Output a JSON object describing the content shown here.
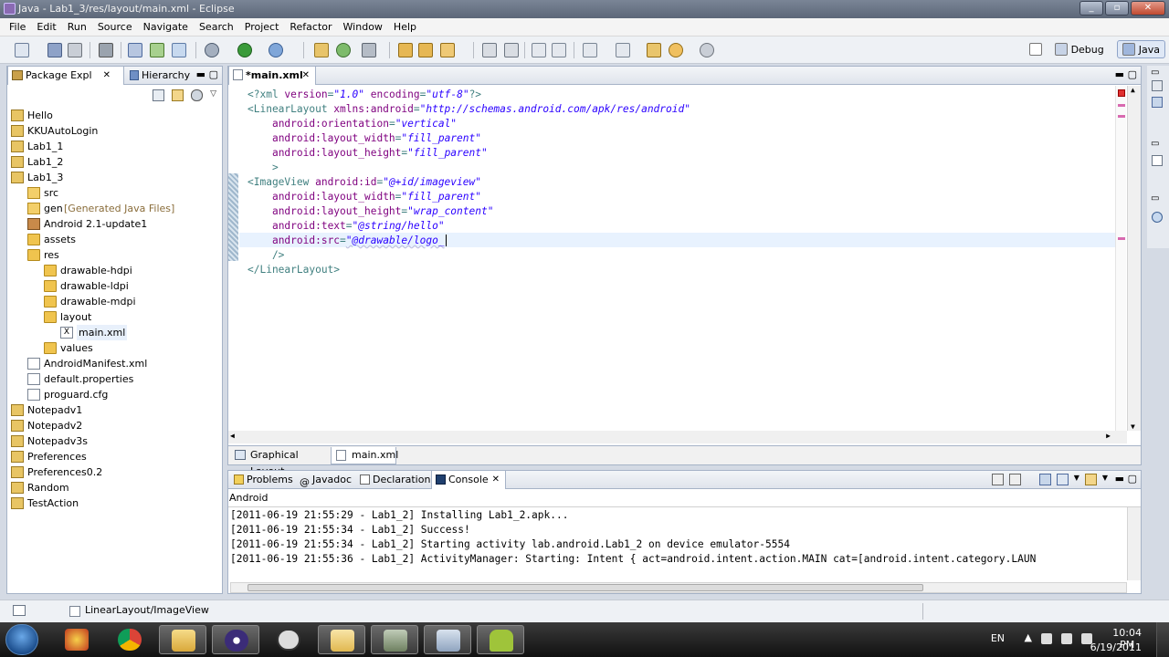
{
  "window": {
    "title": "Java - Lab1_3/res/layout/main.xml - Eclipse"
  },
  "menu": [
    "File",
    "Edit",
    "Run",
    "Source",
    "Navigate",
    "Search",
    "Project",
    "Refactor",
    "Window",
    "Help"
  ],
  "perspectives": {
    "debug": "Debug",
    "java": "Java"
  },
  "left_panel": {
    "tabs": [
      "Package Expl",
      "Hierarchy"
    ],
    "tree": [
      {
        "label": "Hello",
        "type": "project",
        "depth": 0
      },
      {
        "label": "KKUAutoLogin",
        "type": "project",
        "depth": 0
      },
      {
        "label": "Lab1_1",
        "type": "project",
        "depth": 0
      },
      {
        "label": "Lab1_2",
        "type": "project",
        "depth": 0
      },
      {
        "label": "Lab1_3",
        "type": "project",
        "depth": 0
      },
      {
        "label": "src",
        "type": "srcfolder",
        "depth": 1
      },
      {
        "label": "gen",
        "type": "srcfolder",
        "depth": 1,
        "decoration": "[Generated Java Files]"
      },
      {
        "label": "Android 2.1-update1",
        "type": "library",
        "depth": 1
      },
      {
        "label": "assets",
        "type": "folder",
        "depth": 1
      },
      {
        "label": "res",
        "type": "folder",
        "depth": 1
      },
      {
        "label": "drawable-hdpi",
        "type": "folder",
        "depth": 2
      },
      {
        "label": "drawable-ldpi",
        "type": "folder",
        "depth": 2
      },
      {
        "label": "drawable-mdpi",
        "type": "folder",
        "depth": 2
      },
      {
        "label": "layout",
        "type": "folder",
        "depth": 2
      },
      {
        "label": "main.xml",
        "type": "xmlfile",
        "depth": 3
      },
      {
        "label": "values",
        "type": "folder",
        "depth": 2
      },
      {
        "label": "AndroidManifest.xml",
        "type": "file",
        "depth": 1
      },
      {
        "label": "default.properties",
        "type": "file",
        "depth": 1
      },
      {
        "label": "proguard.cfg",
        "type": "file",
        "depth": 1
      },
      {
        "label": "Notepadv1",
        "type": "project",
        "depth": 0
      },
      {
        "label": "Notepadv2",
        "type": "project",
        "depth": 0
      },
      {
        "label": "Notepadv3s",
        "type": "project",
        "depth": 0
      },
      {
        "label": "Preferences",
        "type": "project",
        "depth": 0
      },
      {
        "label": "Preferences0.2",
        "type": "project",
        "depth": 0
      },
      {
        "label": "Random",
        "type": "project",
        "depth": 0
      },
      {
        "label": "TestAction",
        "type": "project",
        "depth": 0
      }
    ]
  },
  "editor": {
    "tab": "*main.xml",
    "bottom_tabs": [
      "Graphical Layout",
      "main.xml"
    ],
    "lines": [
      [
        [
          "tag",
          "<?xml "
        ],
        [
          "att",
          "version"
        ],
        [
          "tag",
          "="
        ],
        [
          "val",
          "\"1.0\""
        ],
        [
          "tag",
          " "
        ],
        [
          "att",
          "encoding"
        ],
        [
          "tag",
          "="
        ],
        [
          "val",
          "\"utf-8\""
        ],
        [
          "tag",
          "?>"
        ]
      ],
      [
        [
          "tag",
          "<LinearLayout "
        ],
        [
          "att",
          "xmlns:android"
        ],
        [
          "tag",
          "="
        ],
        [
          "val",
          "\"http://schemas.android.com/apk/res/android\""
        ]
      ],
      [
        [
          "tag",
          "    "
        ],
        [
          "att",
          "android:orientation"
        ],
        [
          "tag",
          "="
        ],
        [
          "val",
          "\"vertical\""
        ]
      ],
      [
        [
          "tag",
          "    "
        ],
        [
          "att",
          "android:layout_width"
        ],
        [
          "tag",
          "="
        ],
        [
          "val",
          "\"fill_parent\""
        ]
      ],
      [
        [
          "tag",
          "    "
        ],
        [
          "att",
          "android:layout_height"
        ],
        [
          "tag",
          "="
        ],
        [
          "val",
          "\"fill_parent\""
        ]
      ],
      [
        [
          "tag",
          "    >"
        ]
      ],
      [
        [
          "tag",
          "<ImageView "
        ],
        [
          "att",
          "android:id"
        ],
        [
          "tag",
          "="
        ],
        [
          "val",
          "\"@+id/imageview\""
        ]
      ],
      [
        [
          "tag",
          "    "
        ],
        [
          "att",
          "android:layout_width"
        ],
        [
          "tag",
          "="
        ],
        [
          "val",
          "\"fill_parent\""
        ]
      ],
      [
        [
          "tag",
          "    "
        ],
        [
          "att",
          "android:layout_height"
        ],
        [
          "tag",
          "="
        ],
        [
          "val",
          "\"wrap_content\""
        ]
      ],
      [
        [
          "tag",
          "    "
        ],
        [
          "att",
          "android:text"
        ],
        [
          "tag",
          "="
        ],
        [
          "val",
          "\"@string/hello\""
        ]
      ],
      [
        [
          "tag",
          "    "
        ],
        [
          "att",
          "android:src"
        ],
        [
          "tag",
          "="
        ],
        [
          "val",
          "\"@drawable/logo_"
        ]
      ],
      [
        [
          "tag",
          "    />"
        ]
      ],
      [
        [
          "tag",
          "</LinearLayout>"
        ]
      ]
    ]
  },
  "console": {
    "tabs": [
      "Problems",
      "Javadoc",
      "Declaration",
      "Console"
    ],
    "header": "Android",
    "lines": [
      "[2011-06-19 21:55:29 - Lab1_2] Installing Lab1_2.apk...",
      "[2011-06-19 21:55:34 - Lab1_2] Success!",
      "[2011-06-19 21:55:34 - Lab1_2] Starting activity lab.android.Lab1_2 on device emulator-5554",
      "[2011-06-19 21:55:36 - Lab1_2] ActivityManager: Starting: Intent { act=android.intent.action.MAIN cat=[android.intent.category.LAUN"
    ]
  },
  "status": {
    "path": "LinearLayout/ImageView"
  },
  "taskbar": {
    "language": "EN",
    "time": "10:04 PM",
    "date": "6/19/2011"
  }
}
